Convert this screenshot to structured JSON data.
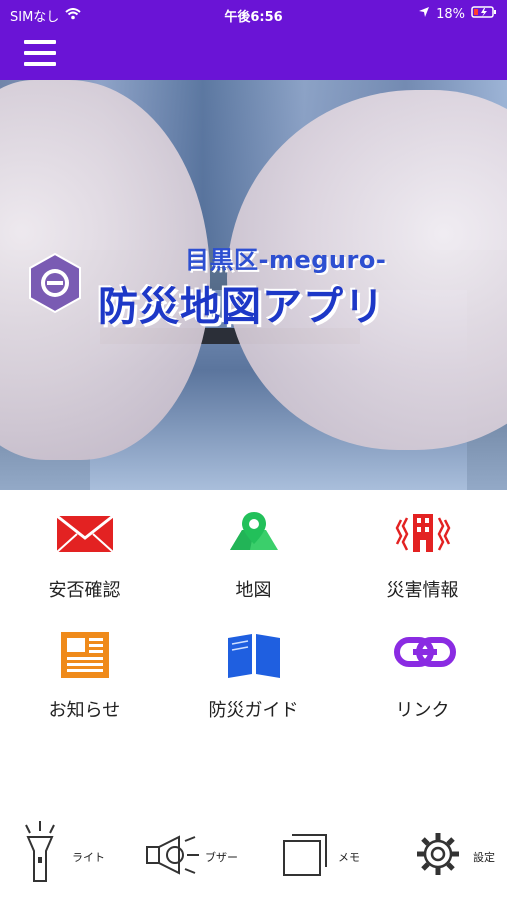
{
  "status_bar": {
    "carrier": "SIMなし",
    "time": "午後6:56",
    "battery": "18%"
  },
  "app_bar": {
    "menu_icon": "hamburger-menu-icon",
    "color": "#6a14d6"
  },
  "hero": {
    "subtitle": "目黒区-meguro-",
    "title": "防災地図アプリ",
    "logo_icon": "meguro-emblem-icon"
  },
  "menu": {
    "items": [
      {
        "label": "安否確認",
        "icon": "envelope-icon",
        "color": "#e32222"
      },
      {
        "label": "地図",
        "icon": "map-pin-icon",
        "color": "#22c05a"
      },
      {
        "label": "災害情報",
        "icon": "building-alert-icon",
        "color": "#e32222"
      },
      {
        "label": "お知らせ",
        "icon": "newspaper-icon",
        "color": "#ef8a1a"
      },
      {
        "label": "防災ガイド",
        "icon": "book-icon",
        "color": "#1f5fe0"
      },
      {
        "label": "リンク",
        "icon": "link-icon",
        "color": "#8a2be2"
      }
    ]
  },
  "bottom_bar": {
    "items": [
      {
        "label": "ライト",
        "icon": "flashlight-icon"
      },
      {
        "label": "ブザー",
        "icon": "buzzer-icon"
      },
      {
        "label": "メモ",
        "icon": "memo-icon"
      },
      {
        "label": "設定",
        "icon": "gear-icon"
      }
    ]
  }
}
